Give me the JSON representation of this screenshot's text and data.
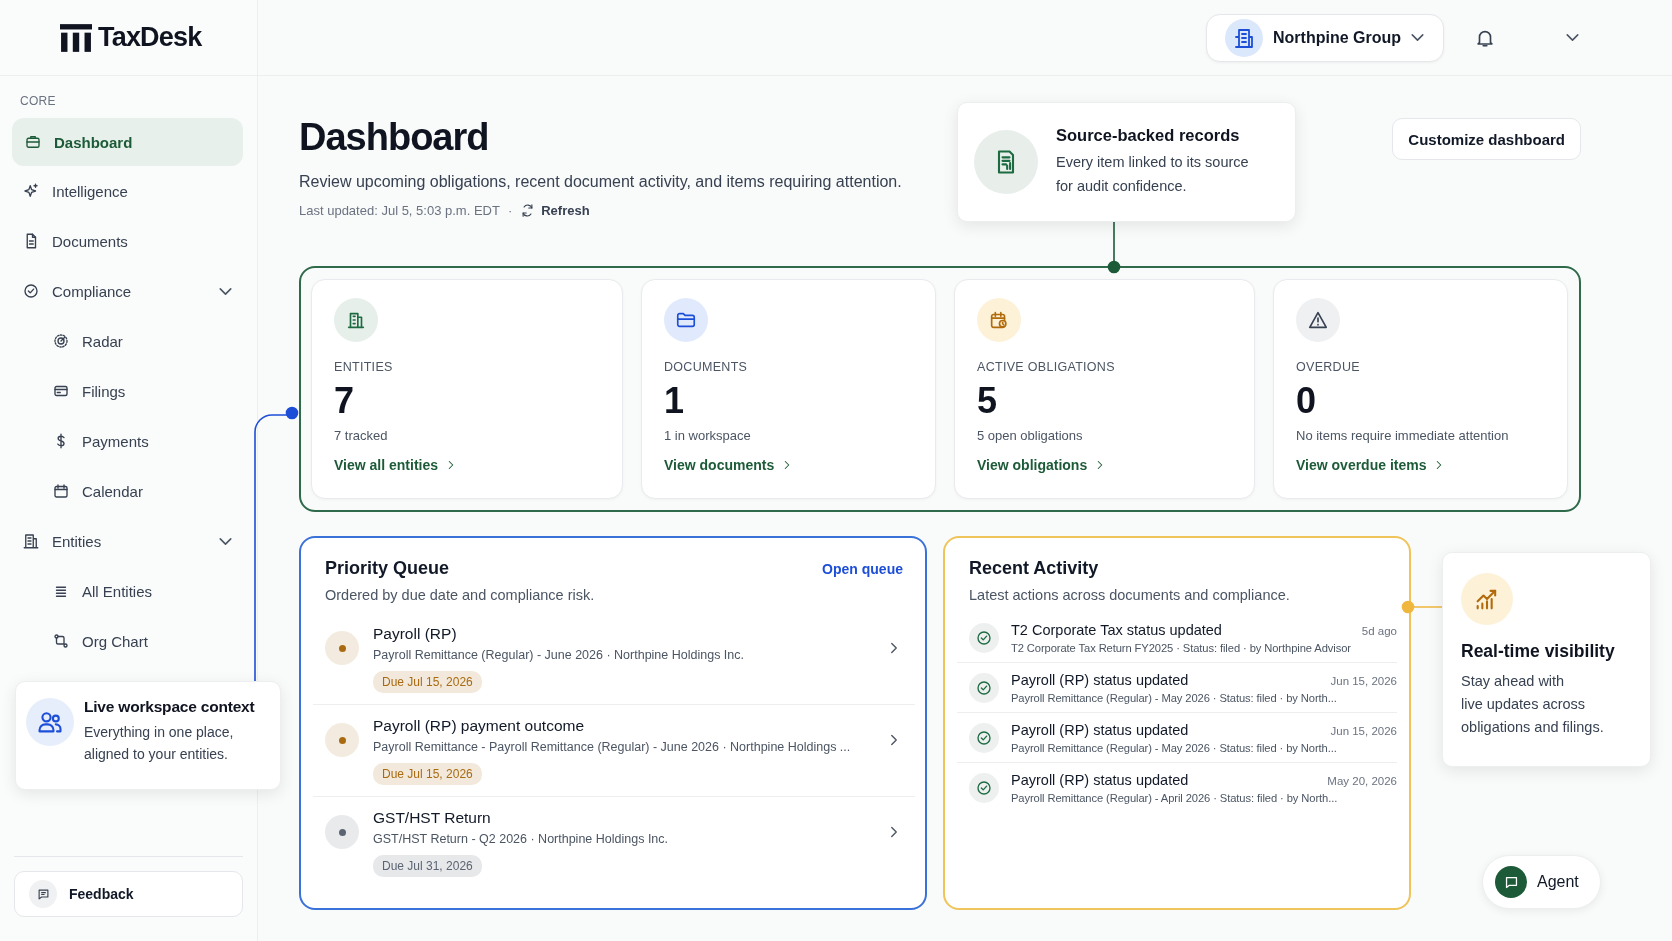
{
  "app": {
    "logo": "TaxDesk"
  },
  "sidebar": {
    "section": "CORE",
    "items": [
      {
        "label": "Dashboard",
        "selected": true
      },
      {
        "label": "Intelligence",
        "selected": false
      },
      {
        "label": "Documents",
        "selected": false
      },
      {
        "label": "Compliance",
        "selected": false,
        "expanded": true,
        "children": [
          {
            "label": "Radar",
            "selected": false
          },
          {
            "label": "Filings",
            "selected": false
          },
          {
            "label": "Payments",
            "selected": false
          },
          {
            "label": "Calendar",
            "selected": false
          }
        ]
      },
      {
        "label": "Entities",
        "selected": false,
        "expanded": true,
        "children": [
          {
            "label": "All Entities",
            "selected": false
          },
          {
            "label": "Org Chart",
            "selected": false
          }
        ]
      }
    ],
    "feedback": "Feedback"
  },
  "header": {
    "org": "Northpine Group"
  },
  "page": {
    "title": "Dashboard",
    "subtitle": "Review upcoming obligations, recent document activity, and items requiring attention.",
    "last_updated": "Last updated: Jul 5, 5:03 p.m. EDT",
    "separator": "·",
    "refresh": "Refresh",
    "customize": "Customize dashboard"
  },
  "stats": [
    {
      "label": "ENTITIES",
      "value": "7",
      "note": "7 tracked",
      "link": "View all entities"
    },
    {
      "label": "DOCUMENTS",
      "value": "1",
      "note": "1 in workspace",
      "link": "View documents"
    },
    {
      "label": "ACTIVE OBLIGATIONS",
      "value": "5",
      "note": "5 open obligations",
      "link": "View obligations"
    },
    {
      "label": "OVERDUE",
      "value": "0",
      "note": "No items require immediate attention",
      "link": "View overdue items"
    }
  ],
  "priority_queue": {
    "title": "Priority Queue",
    "subtitle": "Ordered by due date and compliance risk.",
    "action": "Open queue",
    "items": [
      {
        "title": "Payroll (RP)",
        "detail": "Payroll Remittance (Regular)  -  June 2026 · Northpine Holdings Inc.",
        "due": "Due Jul 15, 2026",
        "color": "#a86b12"
      },
      {
        "title": "Payroll (RP) payment outcome",
        "detail": "Payroll Remittance  -  Payroll Remittance (Regular)  -  June 2026 · Northpine Holdings ...",
        "due": "Due Jul 15, 2026",
        "color": "#a86b12"
      },
      {
        "title": "GST/HST Return",
        "detail": "GST/HST Return - Q2 2026 · Northpine Holdings Inc.",
        "due": "Due Jul 31, 2026",
        "color": "#5b6472"
      }
    ]
  },
  "recent_activity": {
    "title": "Recent Activity",
    "subtitle": "Latest actions across documents and compliance.",
    "items": [
      {
        "title": "T2 Corporate Tax status updated",
        "time": "5d ago",
        "detail": "T2 Corporate Tax Return FY2025 · Status: filed · by Northpine Advisor"
      },
      {
        "title": "Payroll (RP) status updated",
        "time": "Jun 15, 2026",
        "detail": "Payroll Remittance (Regular)  -  May 2026 · Status: filed · by North..."
      },
      {
        "title": "Payroll (RP) status updated",
        "time": "Jun 15, 2026",
        "detail": "Payroll Remittance (Regular)  -  May 2026 · Status: filed · by North..."
      },
      {
        "title": "Payroll (RP) status updated",
        "time": "May 20, 2026",
        "detail": "Payroll Remittance (Regular)  -  April 2026 · Status: filed · by North..."
      }
    ]
  },
  "source_callout": {
    "title": "Source-backed records",
    "text": "Every item linked to its source\nfor audit confidence."
  },
  "workspace_callout": {
    "title": "Live workspace context",
    "text": "Everything in one place,\naligned to your entities."
  },
  "realtime_callout": {
    "title": "Real-time visibility",
    "text": "Stay ahead with\nlive updates across\nobligations and filings."
  },
  "agent": {
    "label": "Agent"
  }
}
